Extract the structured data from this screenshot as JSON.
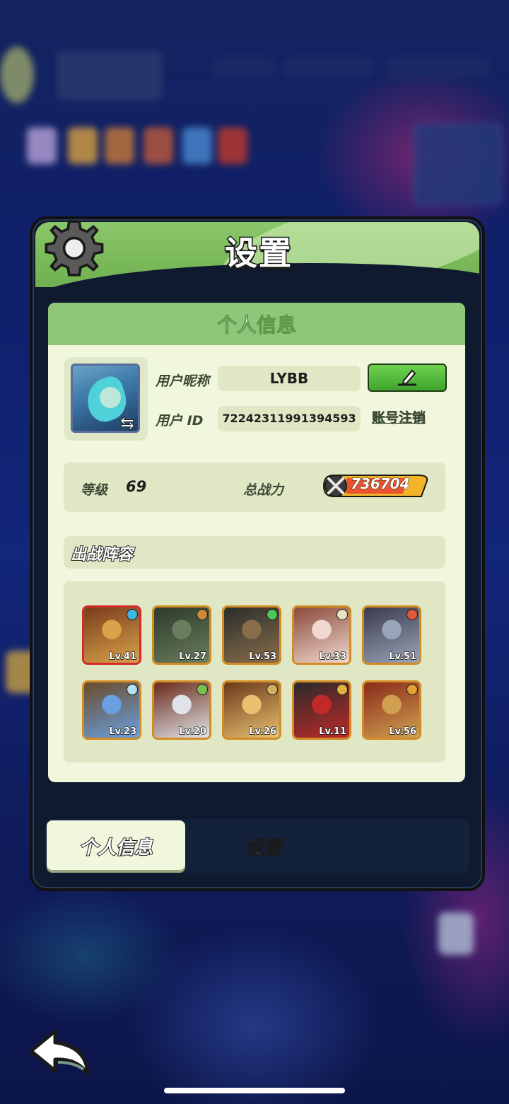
{
  "dialog": {
    "title": "设置",
    "panel_title": "个人信息"
  },
  "profile": {
    "nickname_label": "用户昵称",
    "nickname": "LYBB",
    "id_label": "用户 ID",
    "user_id": "72242311991394593",
    "deregister_label": "账号注销"
  },
  "stats": {
    "level_label": "等级",
    "level": "69",
    "power_label": "总战力",
    "power": "736704"
  },
  "lineup": {
    "title": "出战阵容",
    "heroes": [
      {
        "level": "Lv.41",
        "frame": "red",
        "palette": [
          "#7a3b1c",
          "#d8a34a"
        ],
        "gem": "#3fb6e0"
      },
      {
        "level": "Lv.27",
        "frame": "orange",
        "palette": [
          "#2c3a2a",
          "#6a7d5e"
        ],
        "gem": "#c98a3a"
      },
      {
        "level": "Lv.53",
        "frame": "orange",
        "palette": [
          "#2a2e2c",
          "#8a6d4a"
        ],
        "gem": "#4fc45a"
      },
      {
        "level": "Lv.33",
        "frame": "orange",
        "palette": [
          "#8a4a3a",
          "#f0d8d0"
        ],
        "gem": "#e8e0c0"
      },
      {
        "level": "Lv.51",
        "frame": "orange",
        "palette": [
          "#3a3a4e",
          "#9aa4b8"
        ],
        "gem": "#e05a3a"
      },
      {
        "level": "Lv.23",
        "frame": "orange",
        "palette": [
          "#6a4a2a",
          "#6aa0e0"
        ],
        "gem": "#b8e0f0"
      },
      {
        "level": "Lv.20",
        "frame": "orange",
        "palette": [
          "#6a2a1a",
          "#e0e4e8"
        ],
        "gem": "#7ac050"
      },
      {
        "level": "Lv.26",
        "frame": "orange",
        "palette": [
          "#6a3a1a",
          "#e8c070"
        ],
        "gem": "#d0b060"
      },
      {
        "level": "Lv.11",
        "frame": "orange",
        "palette": [
          "#2a2a2a",
          "#c02a2a"
        ],
        "gem": "#e0b040"
      },
      {
        "level": "Lv.56",
        "frame": "orange",
        "palette": [
          "#8a2a1a",
          "#d0a050"
        ],
        "gem": "#e0a030"
      }
    ]
  },
  "tabs": {
    "active": "个人信息",
    "inactive": "设置"
  },
  "colors": {
    "header_green": "#7fbf5e",
    "panel_bg": "#f1f7dc",
    "edit_button": "#4fb43a",
    "power_badge": "#f2b52a"
  }
}
